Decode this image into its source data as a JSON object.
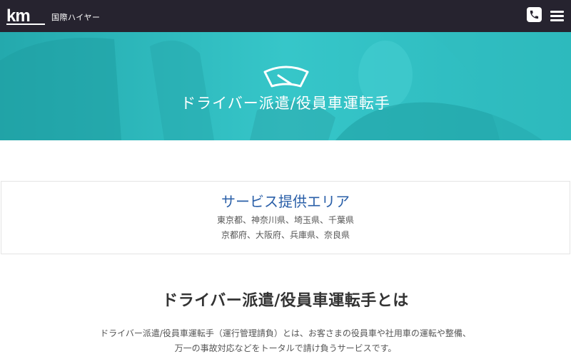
{
  "header": {
    "brand": "国際ハイヤー",
    "logo_text": "km",
    "phone_icon": "phone-icon",
    "menu_icon": "hamburger-menu-icon"
  },
  "hero": {
    "title": "ドライバー派遣/役員車運転手",
    "icon": "windshield-wiper-icon"
  },
  "service_area": {
    "title": "サービス提供エリア",
    "line1": "東京都、神奈川県、埼玉県、千葉県",
    "line2": "京都府、大阪府、兵庫県、奈良県"
  },
  "about": {
    "title": "ドライバー派遣/役員車運転手とは",
    "line1": "ドライバー派遣/役員車運転手（運行管理請負）とは、お客さまの役員車や社用車の運転や整備、",
    "line2": "万一の事故対応などをトータルで請け負うサービスです。"
  },
  "colors": {
    "header_bg": "#26232f",
    "hero_bg": "#2bbcc0",
    "accent_blue": "#2a5fa8"
  }
}
